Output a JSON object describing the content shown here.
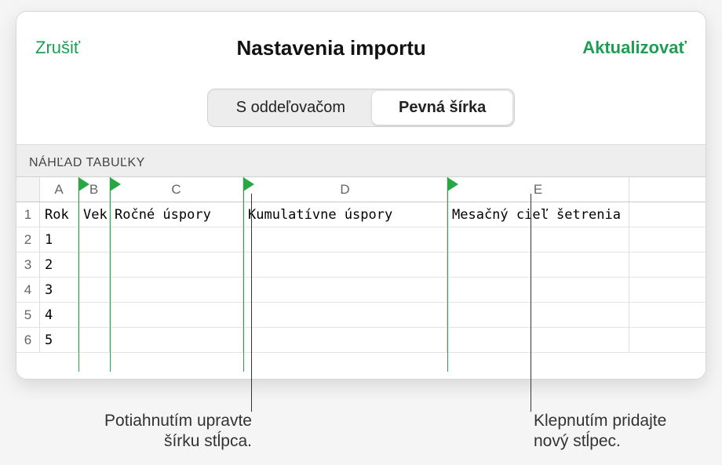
{
  "header": {
    "cancel": "Zrušiť",
    "title": "Nastavenia importu",
    "update": "Aktualizovať"
  },
  "segmented": {
    "delimited": "S oddeľovačom",
    "fixed": "Pevná šírka"
  },
  "section_label": "NÁHĽAD TABUĽKY",
  "columns": [
    "A",
    "B",
    "C",
    "D",
    "E"
  ],
  "row_numbers": [
    "1",
    "2",
    "3",
    "4",
    "5",
    "6"
  ],
  "header_row": [
    "Rok",
    "Vek",
    "Ročné úspory",
    "Kumulatívne úspory",
    "Mesačný cieľ šetrenia"
  ],
  "data_rows": [
    [
      "1",
      "",
      "",
      "",
      ""
    ],
    [
      "2",
      "",
      "",
      "",
      ""
    ],
    [
      "3",
      "",
      "",
      "",
      ""
    ],
    [
      "4",
      "",
      "",
      "",
      ""
    ],
    [
      "5",
      "",
      "",
      "",
      ""
    ]
  ],
  "annotations": {
    "drag_line1": "Potiahnutím upravte",
    "drag_line2": "šírku stĺpca.",
    "tap_line1": "Klepnutím pridajte",
    "tap_line2": "nový stĺpec."
  }
}
